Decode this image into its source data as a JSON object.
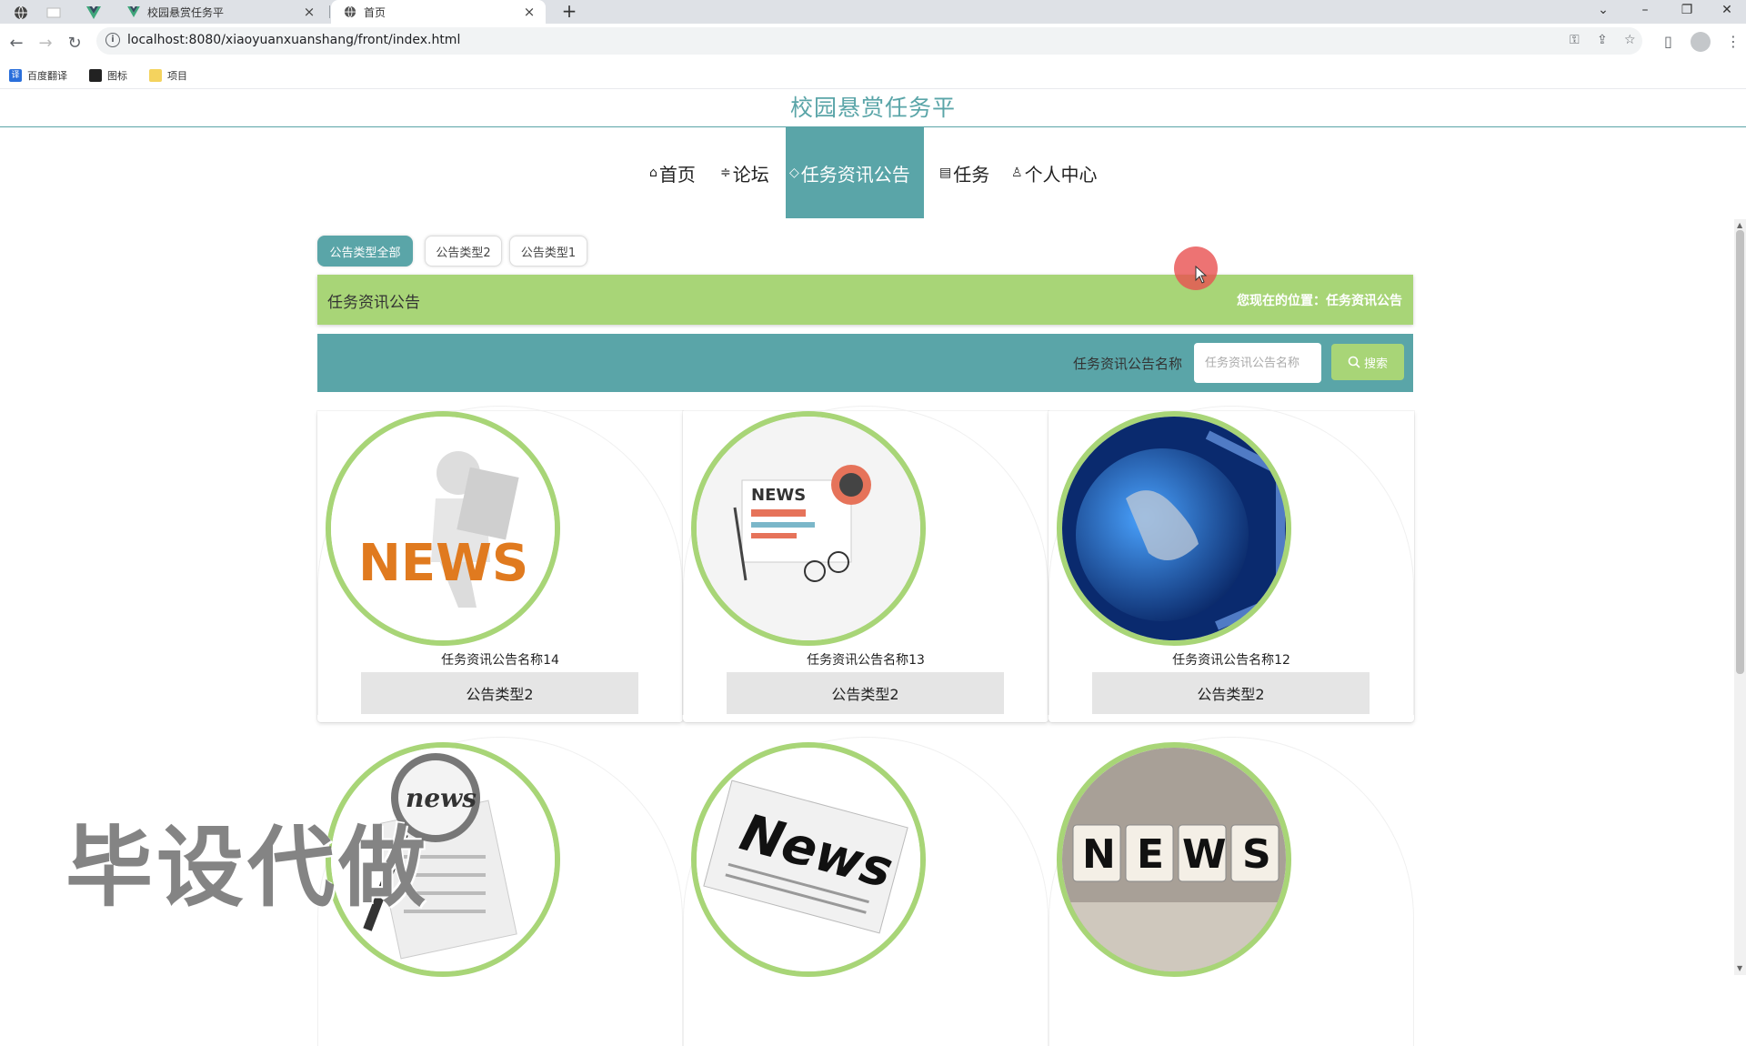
{
  "browser": {
    "tabs": [
      {
        "title": "校园悬赏任务平",
        "active": false
      },
      {
        "title": "首页",
        "active": true
      }
    ],
    "url": "localhost:8080/xiaoyuanxuanshang/front/index.html",
    "bookmarks": [
      "百度翻译",
      "图标",
      "项目"
    ],
    "new_tab": "+"
  },
  "site": {
    "title": "校园悬赏任务平"
  },
  "nav": {
    "items": [
      {
        "label": "首页",
        "icon": "home-icon"
      },
      {
        "label": "论坛",
        "icon": "forum-icon"
      },
      {
        "label": "任务资讯公告",
        "icon": "tag-icon",
        "active": true
      },
      {
        "label": "任务",
        "icon": "document-icon"
      },
      {
        "label": "个人中心",
        "icon": "user-icon"
      }
    ]
  },
  "filters": [
    "公告类型全部",
    "公告类型2",
    "公告类型1"
  ],
  "section": {
    "title": "任务资讯公告",
    "breadcrumb": "您现在的位置：任务资讯公告"
  },
  "search": {
    "label": "任务资讯公告名称",
    "placeholder": "任务资讯公告名称",
    "button": "搜索"
  },
  "cards": [
    {
      "name": "任务资讯公告名称14",
      "type": "公告类型2"
    },
    {
      "name": "任务资讯公告名称13",
      "type": "公告类型2"
    },
    {
      "name": "任务资讯公告名称12",
      "type": "公告类型2"
    },
    {
      "name": "",
      "type": ""
    },
    {
      "name": "",
      "type": ""
    },
    {
      "name": "",
      "type": ""
    }
  ],
  "watermark": "毕设代做",
  "colors": {
    "primary": "#5aa5a8",
    "accent": "#a8d577"
  }
}
